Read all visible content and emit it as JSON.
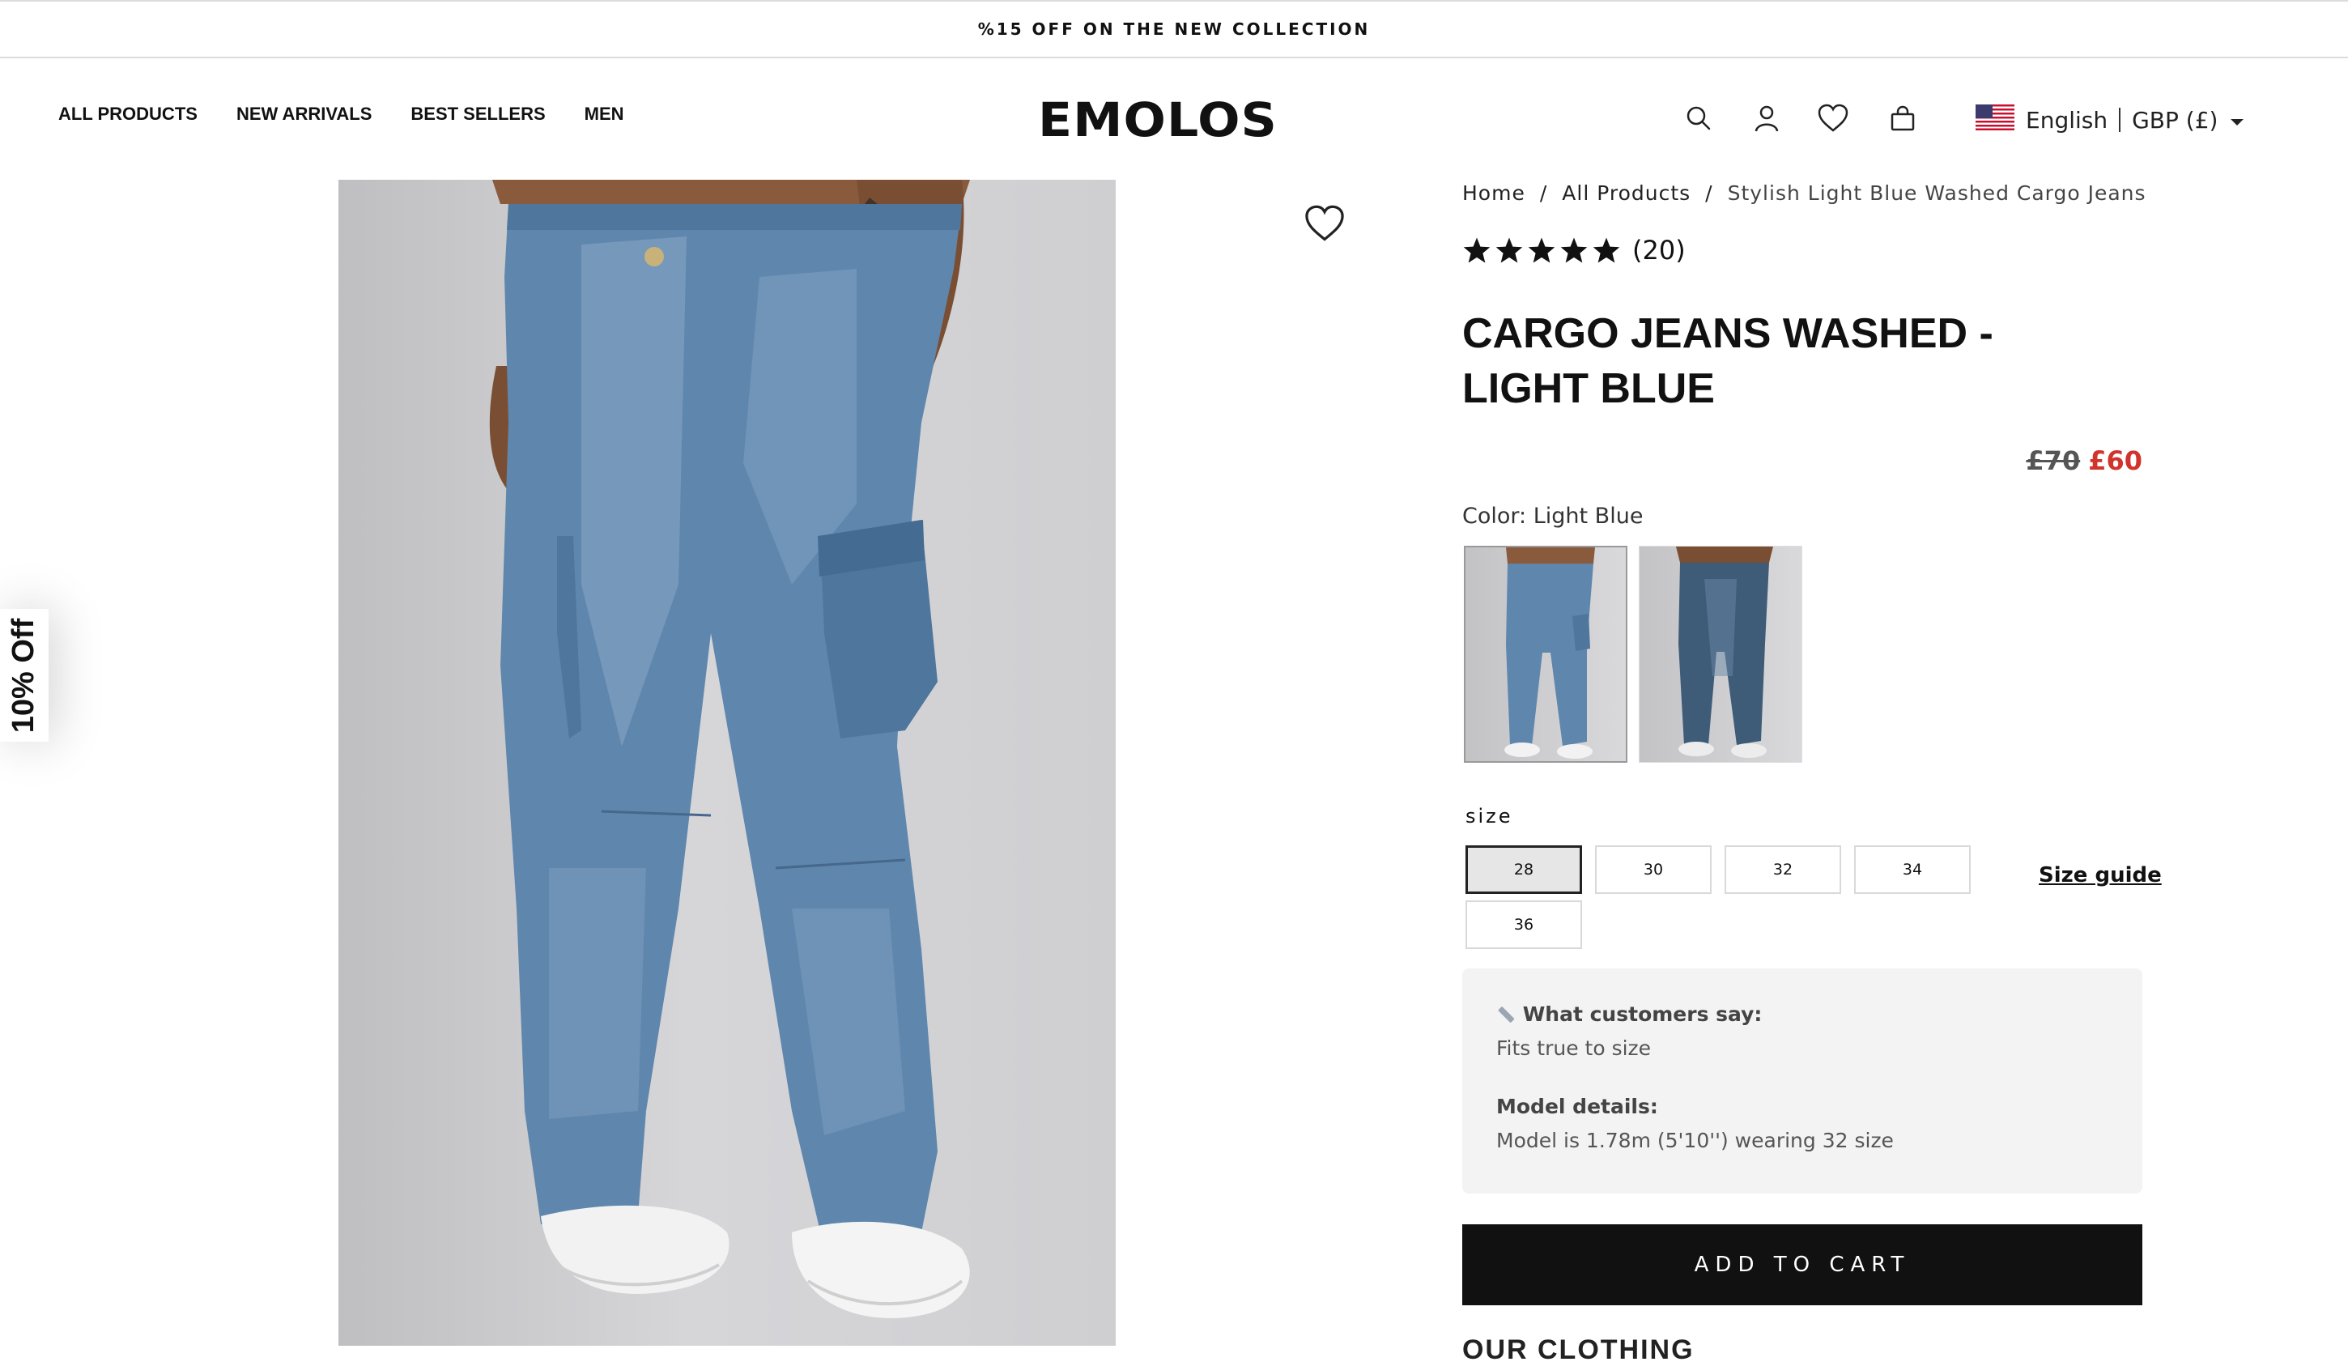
{
  "announcement": {
    "text": "%15 OFF ON THE NEW COLLECTION"
  },
  "nav": {
    "items": [
      "ALL PRODUCTS",
      "NEW ARRIVALS",
      "BEST SELLERS",
      "MEN"
    ]
  },
  "brand": {
    "logo_text": "EMOLOS"
  },
  "header": {
    "icons": [
      "search-icon",
      "account-icon",
      "wishlist-icon",
      "cart-icon"
    ],
    "language": "English",
    "currency": "GBP (£)"
  },
  "side_tab": {
    "label": "10% Off"
  },
  "breadcrumb": {
    "items": [
      "Home",
      "All Products",
      "Stylish Light Blue Washed Cargo Jeans"
    ],
    "separator": "/"
  },
  "rating": {
    "stars": 5,
    "count": "(20)"
  },
  "product": {
    "title": "CARGO JEANS WASHED - LIGHT BLUE",
    "price_old": "£70",
    "price_new": "£60",
    "color_label": "Color:",
    "color_value": "Light Blue",
    "selected_swatch": 1,
    "size_label": "size",
    "sizes": [
      "28",
      "30",
      "32",
      "34",
      "36"
    ],
    "selected_size": "28",
    "size_guide": "Size guide"
  },
  "info": {
    "customers_heading": "What customers say:",
    "customers_text": "Fits true to size",
    "model_heading": "Model details:",
    "model_text": "Model is 1.78m (5'10'') wearing 32 size"
  },
  "cta": {
    "add_to_cart": "ADD TO CART"
  },
  "next_section": {
    "heading": "OUR CLOTHING"
  },
  "colors": {
    "price_sale": "#d0342c",
    "button_bg": "#111111",
    "info_bg": "#f3f3f3"
  }
}
